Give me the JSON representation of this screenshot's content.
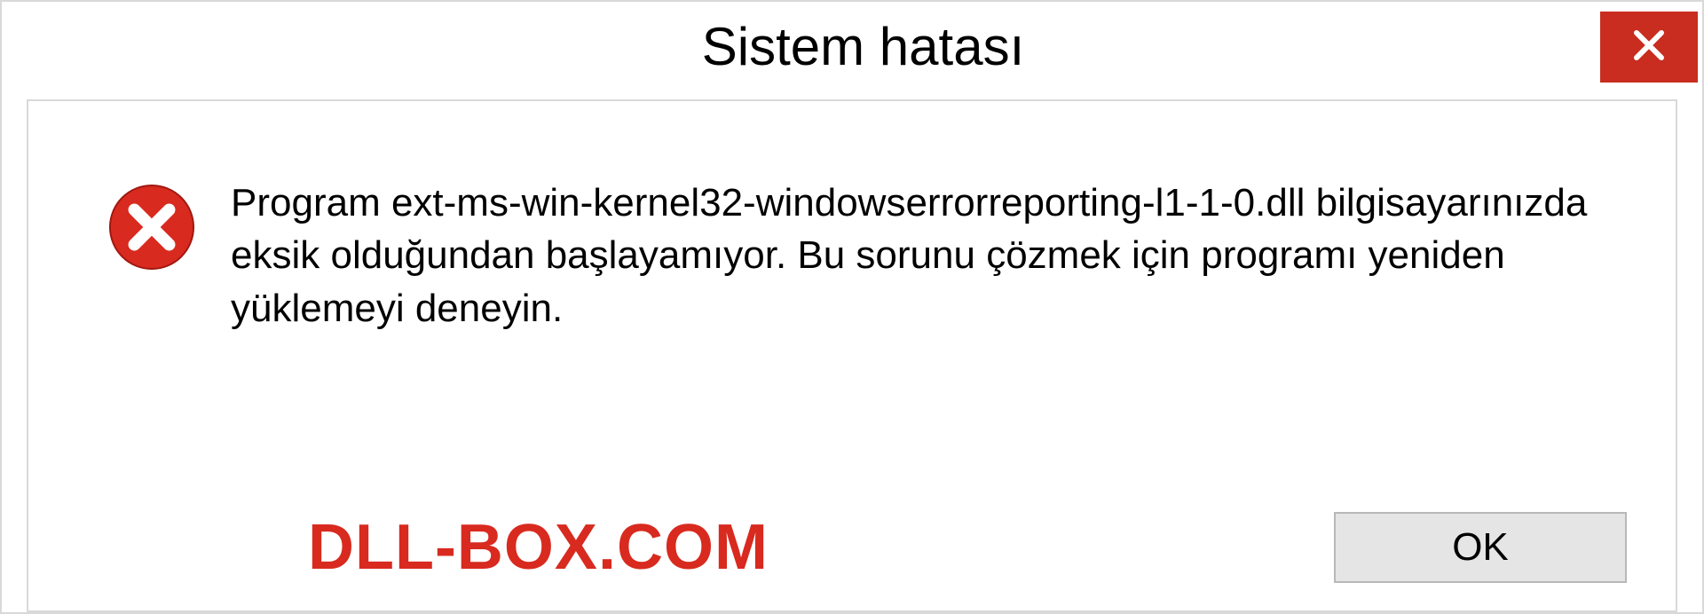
{
  "dialog": {
    "title": "Sistem hatası",
    "message": "Program ext-ms-win-kernel32-windowserrorreporting-l1-1-0.dll bilgisayarınızda eksik olduğundan başlayamıyor. Bu sorunu çözmek için programı yeniden yüklemeyi deneyin.",
    "brand": "DLL-BOX.COM",
    "ok_label": "OK"
  },
  "colors": {
    "close_bg": "#c82d1f",
    "error_icon": "#d82a1f",
    "brand": "#d82a1f"
  }
}
